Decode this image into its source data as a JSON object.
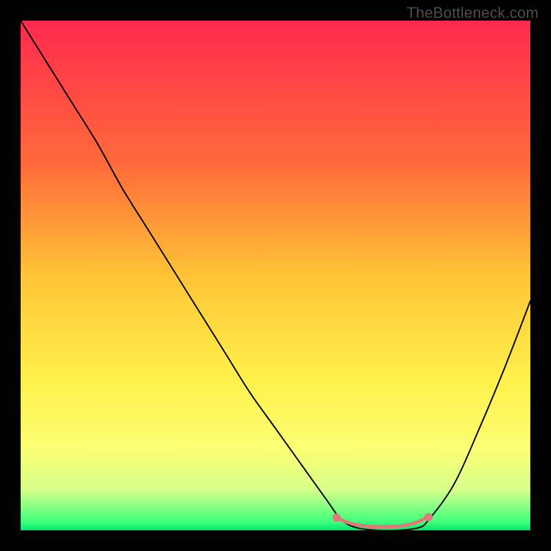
{
  "watermark": "TheBottleneck.com",
  "chart_data": {
    "type": "line",
    "title": "",
    "xlabel": "",
    "ylabel": "",
    "xlim": [
      0,
      100
    ],
    "ylim": [
      0,
      100
    ],
    "background_gradient": {
      "stops": [
        {
          "offset": 0.0,
          "color": "#ff2a4d"
        },
        {
          "offset": 0.28,
          "color": "#ff6a3a"
        },
        {
          "offset": 0.5,
          "color": "#ffc436"
        },
        {
          "offset": 0.7,
          "color": "#fff04a"
        },
        {
          "offset": 0.84,
          "color": "#fbff73"
        },
        {
          "offset": 0.92,
          "color": "#d6ff8a"
        },
        {
          "offset": 0.985,
          "color": "#3bff7c"
        },
        {
          "offset": 1.0,
          "color": "#00e56a"
        }
      ]
    },
    "series": [
      {
        "name": "bottleneck-curve",
        "color": "#000000",
        "stroke_width": 2.0,
        "x": [
          0,
          5,
          10,
          15,
          20,
          25,
          30,
          35,
          40,
          45,
          50,
          55,
          60,
          63,
          66,
          70,
          74,
          78,
          80,
          85,
          90,
          95,
          100
        ],
        "y": [
          100,
          92,
          84,
          76,
          67,
          59,
          51,
          43,
          35,
          27,
          20,
          13,
          6,
          2,
          0.5,
          0,
          0,
          0.5,
          2,
          9,
          20,
          32,
          45
        ]
      }
    ],
    "markers": {
      "name": "highlight-segment",
      "color": "#e07a7a",
      "radius": 6,
      "stroke_width": 5,
      "x": [
        62,
        64,
        66,
        68,
        70,
        72,
        74,
        76,
        78,
        80
      ],
      "y": [
        2.5,
        1.6,
        1.1,
        0.8,
        0.7,
        0.7,
        0.8,
        1.1,
        1.7,
        2.6
      ]
    }
  }
}
